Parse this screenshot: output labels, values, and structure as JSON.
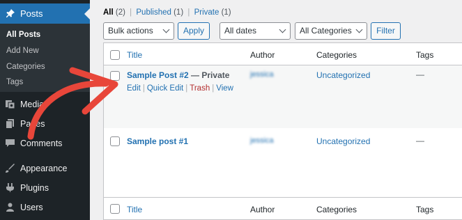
{
  "sidebar": {
    "active": {
      "label": "Posts",
      "icon": "pin-icon"
    },
    "submenu": [
      {
        "label": "All Posts",
        "current": true
      },
      {
        "label": "Add New",
        "current": false
      },
      {
        "label": "Categories",
        "current": false
      },
      {
        "label": "Tags",
        "current": false
      }
    ],
    "menu": [
      {
        "label": "Media",
        "icon": "media-icon"
      },
      {
        "label": "Pages",
        "icon": "pages-icon"
      },
      {
        "label": "Comments",
        "icon": "comments-icon"
      },
      {
        "label": "Appearance",
        "icon": "appearance-icon"
      },
      {
        "label": "Plugins",
        "icon": "plugins-icon"
      },
      {
        "label": "Users",
        "icon": "users-icon"
      }
    ]
  },
  "views": {
    "all": "All",
    "all_count": "(2)",
    "published": "Published",
    "published_count": "(1)",
    "private": "Private",
    "private_count": "(1)",
    "sep": "|"
  },
  "filters": {
    "bulk_actions": "Bulk actions",
    "apply": "Apply",
    "dates": "All dates",
    "categories": "All Categories",
    "filter": "Filter"
  },
  "table": {
    "columns": {
      "title": "Title",
      "author": "Author",
      "categories": "Categories",
      "tags": "Tags"
    },
    "rows": [
      {
        "title": "Sample Post #2",
        "state": " — Private",
        "author": "jessica",
        "category": "Uncategorized",
        "tags": "—",
        "actions": {
          "edit": "Edit",
          "quick_edit": "Quick Edit",
          "trash": "Trash",
          "view": "View"
        }
      },
      {
        "title": "Sample post #1",
        "state": "",
        "author": "jessica",
        "category": "Uncategorized",
        "tags": "—"
      }
    ]
  },
  "colors": {
    "sidebar_bg": "#1d2327",
    "active_bg": "#2271b1",
    "link": "#2271b1",
    "trash": "#b32d2e",
    "arrow": "#e8463a"
  }
}
